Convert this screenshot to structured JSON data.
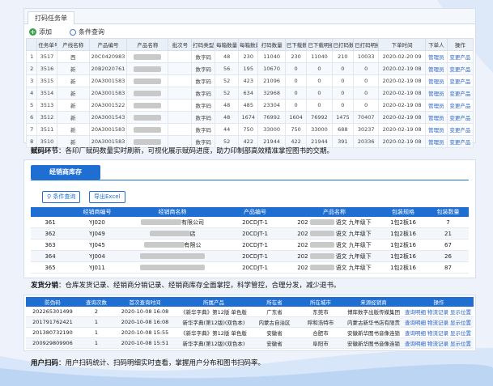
{
  "panel1": {
    "tab": "打码任务单",
    "toolbar": {
      "add": "添加",
      "search": "条件查询"
    },
    "headers": [
      "任务单号",
      "产线名称",
      "产品编号",
      "产品名称",
      "批次号",
      "打码类型",
      "每箱数量",
      "每箱数量",
      "打码数量",
      "已下载数",
      "已下载明细",
      "已打码数",
      "已打码明细",
      "下单时间",
      "下单人",
      "操作"
    ],
    "rows": [
      {
        "n": "1",
        "id": "3517",
        "line": "西",
        "code": "20C0420983",
        "type": "数字码",
        "a": "48",
        "b": "230",
        "qty": "11040",
        "d1": "230",
        "d2": "11040",
        "d3": "210",
        "d4": "10033",
        "time": "2020-02-20 09",
        "user": "管理员",
        "op": "变更产品"
      },
      {
        "n": "2",
        "id": "3516",
        "line": "新",
        "code": "20B2020761",
        "type": "数字码",
        "a": "56",
        "b": "195",
        "qty": "10670",
        "d1": "0",
        "d2": "0",
        "d3": "0",
        "d4": "0",
        "time": "2020-02-19 08",
        "user": "管理员",
        "op": "变更产品"
      },
      {
        "n": "3",
        "id": "3515",
        "line": "新",
        "code": "20A3001583",
        "type": "数字码",
        "a": "52",
        "b": "423",
        "qty": "21096",
        "d1": "0",
        "d2": "0",
        "d3": "0",
        "d4": "0",
        "time": "2020-02-19 08",
        "user": "管理员",
        "op": "变更产品"
      },
      {
        "n": "4",
        "id": "3514",
        "line": "新",
        "code": "20A3001583",
        "type": "数字码",
        "a": "52",
        "b": "634",
        "qty": "32968",
        "d1": "0",
        "d2": "0",
        "d3": "0",
        "d4": "0",
        "time": "2020-02-19 08",
        "user": "管理员",
        "op": "变更产品"
      },
      {
        "n": "5",
        "id": "3513",
        "line": "新",
        "code": "20A3001522",
        "type": "数字码",
        "a": "48",
        "b": "485",
        "qty": "23304",
        "d1": "0",
        "d2": "0",
        "d3": "0",
        "d4": "0",
        "time": "2020-02-19 08",
        "user": "管理员",
        "op": "变更产品"
      },
      {
        "n": "6",
        "id": "3512",
        "line": "新",
        "code": "20A3001543",
        "type": "数字码",
        "a": "48",
        "b": "1674",
        "qty": "76992",
        "d1": "1604",
        "d2": "76992",
        "d3": "1475",
        "d4": "70407",
        "time": "2020-02-19 08",
        "user": "管理员",
        "op": "变更产品"
      },
      {
        "n": "7",
        "id": "3511",
        "line": "新",
        "code": "20A3001583",
        "type": "数字码",
        "a": "44",
        "b": "750",
        "qty": "33000",
        "d1": "750",
        "d2": "33000",
        "d3": "688",
        "d4": "30237",
        "time": "2020-02-19 08",
        "user": "管理员",
        "op": "变更产品"
      },
      {
        "n": "8",
        "id": "3510",
        "line": "新",
        "code": "20A3001583",
        "type": "数字码",
        "a": "52",
        "b": "422",
        "qty": "21944",
        "d1": "422",
        "d2": "21944",
        "d3": "391",
        "d4": "20336",
        "time": "2020-02-19 08",
        "user": "管理员",
        "op": "变更产品"
      }
    ]
  },
  "caption1": {
    "bold": "赋码环节",
    "text": "：各印厂赋码数量实时刷新，可视化展示赋码进度，助力印制部高效精准掌控图书的交期。"
  },
  "panel2": {
    "title": "经销商库存",
    "buttons": {
      "search": "条件查询",
      "export": "导出Excel"
    },
    "headers": [
      "",
      "经销商编号",
      "经销商名称",
      "产品编号",
      "产品名称",
      "包装规格",
      "包装数量"
    ],
    "rows": [
      {
        "n": "361",
        "code": "YJ020",
        "name": "有限公司",
        "pcode": "20CDJT-1",
        "pname": "202",
        "grade": "语文 九年级下",
        "spec": "1包2板16",
        "qty": "7"
      },
      {
        "n": "362",
        "code": "YJ049",
        "name": "店",
        "pcode": "20CDJT-1",
        "pname": "202",
        "grade": "语文 九年级下",
        "spec": "1包2板16",
        "qty": "21"
      },
      {
        "n": "363",
        "code": "YJ045",
        "name": "有限公",
        "pcode": "20CDJT-1",
        "pname": "202",
        "grade": "语文 九年级下",
        "spec": "1包2板16",
        "qty": "67"
      },
      {
        "n": "364",
        "code": "YJ004",
        "name": "",
        "pcode": "20CDJT-1",
        "pname": "202",
        "grade": "语文 九年级下",
        "spec": "1包2板16",
        "qty": "26"
      },
      {
        "n": "365",
        "code": "YJ011",
        "name": "",
        "pcode": "20CDJT-1",
        "pname": "202",
        "grade": "语文 九年级下",
        "spec": "1包2板16",
        "qty": "87"
      }
    ]
  },
  "caption2": {
    "bold": "发货分销",
    "text": "：仓库发货记录、经销商分销记录、经销商库存全面掌控，科学管控，合理分发，减少退书。"
  },
  "panel3": {
    "headers": [
      "防伪码",
      "查询次数",
      "首次查询时间",
      "所属产品",
      "所在省",
      "所在城市",
      "来源经销商",
      "操作"
    ],
    "rows": [
      {
        "code": "202265301499",
        "count": "2",
        "time": "2020-10-08 16:08",
        "product": "《新华字典》第12版 单色版",
        "prov": "广东省",
        "city": "东莞市",
        "dealer": "博库数字出版传媒集团",
        "ops": [
          "查询明细",
          "物流记录",
          "显示位置"
        ]
      },
      {
        "code": "201791762421",
        "count": "1",
        "time": "2020-10-08 16:08",
        "product": "新华字典(第12版)(双色本)",
        "prov": "内蒙古自治区",
        "city": "呼和浩特市",
        "dealer": "内蒙古新华书店有限责",
        "ops": [
          "查询明细",
          "物流记录",
          "显示位置"
        ]
      },
      {
        "code": "201380732190",
        "count": "1",
        "time": "2020-10-08 15:55",
        "product": "《新华字典》第12版 单色版",
        "prov": "安徽省",
        "city": "合肥市",
        "dealer": "安徽新华图书音像连锁",
        "ops": [
          "查询明细",
          "物流记录",
          "显示位置"
        ]
      },
      {
        "code": "200929809906",
        "count": "1",
        "time": "2020-10-08 15:51",
        "product": "新华字典(第12版)(双色本)",
        "prov": "安徽省",
        "city": "阜阳市",
        "dealer": "安徽新华图书音像连锁",
        "ops": [
          "查询明细",
          "物流记录",
          "显示位置"
        ]
      }
    ]
  },
  "caption3": {
    "bold": "用户扫码",
    "text": "：用户扫码统计、扫码明细实时查看，掌握用户分布和图书扫码率。"
  },
  "colors": {
    "accent": "#1f6fd2",
    "link": "#2b64c4",
    "add_icon": "#3aa34a"
  }
}
